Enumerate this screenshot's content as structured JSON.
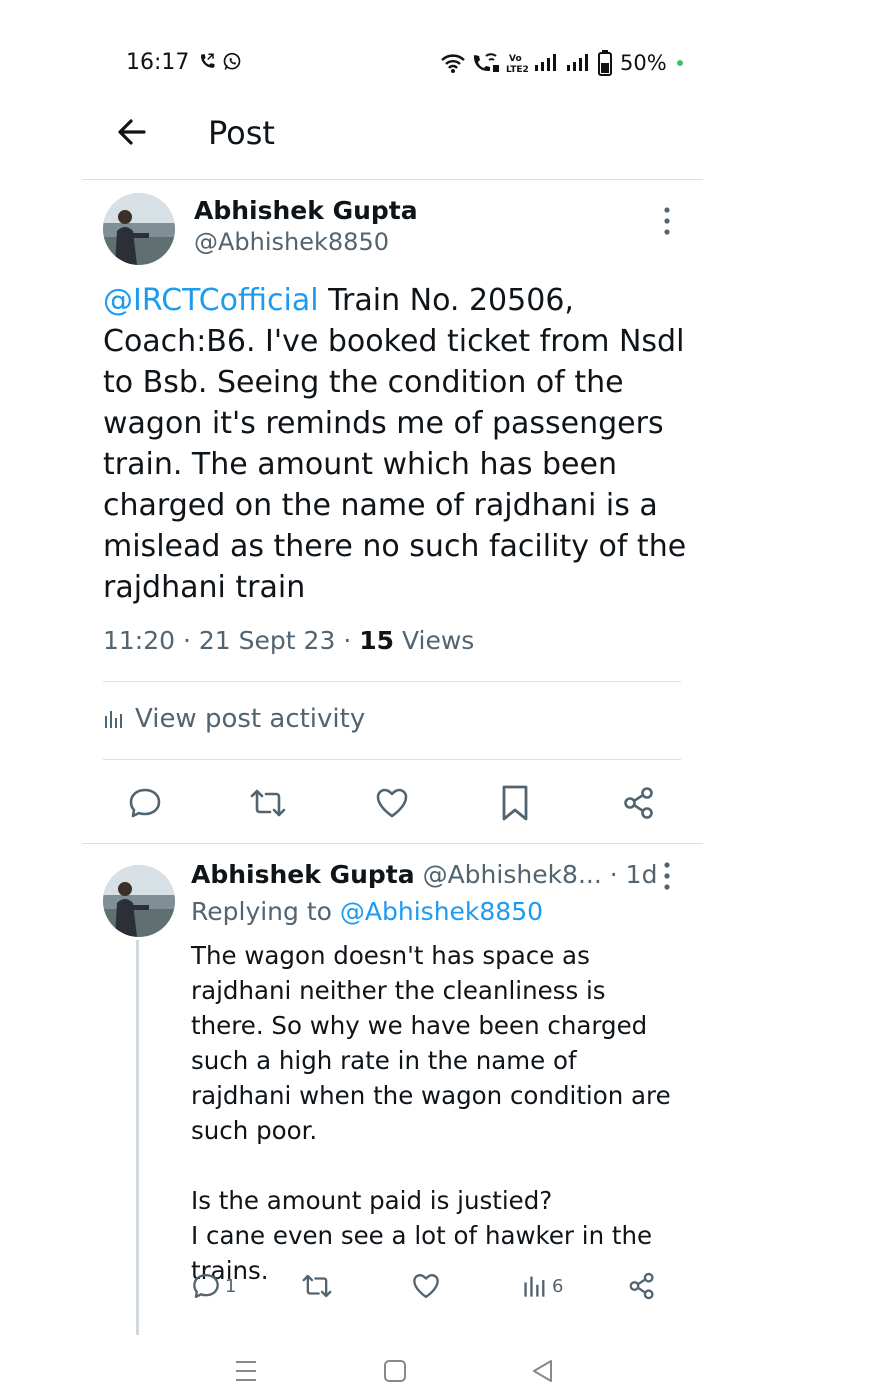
{
  "status_bar": {
    "time": "16:17",
    "battery": "50%",
    "left_icons": [
      "call-forward-icon",
      "whatsapp-icon"
    ],
    "right_icons": [
      "wifi-icon",
      "wifi-call-icon",
      "volte-icon",
      "signal-icon",
      "signal-icon",
      "battery-icon"
    ]
  },
  "header": {
    "title": "Post"
  },
  "post": {
    "author_name": "Abhishek Gupta",
    "author_handle": "@Abhishek8850",
    "mention": "@IRCTCofficial",
    "text": " Train No. 20506, Coach:B6. I've booked ticket from Nsdl to Bsb. Seeing the condition of the wagon it's reminds me of passengers train. The amount which has been charged on the name of rajdhani is a mislead as there no such facility of the rajdhani train",
    "time": "11:20",
    "date": "21 Sept 23",
    "views_count": "15",
    "views_label": "Views",
    "activity_label": "View post activity"
  },
  "reply": {
    "author_name": "Abhishek Gupta",
    "author_handle": "@Abhishek8...",
    "age": "· 1d",
    "replying_prefix": "Replying to",
    "replying_handle": "@Abhishek8850",
    "text": "The wagon doesn't has space as rajdhani neither the cleanliness is there. So why we have been charged such a high rate in the name of rajdhani when the wagon condition are such poor.\n\nIs the amount paid is justied?\nI cane even see a lot of hawker in the trains.",
    "reply_count": "1",
    "views_count": "6"
  },
  "colors": {
    "accent": "#1d9bf0",
    "secondary_text": "#536471",
    "divider": "#dcdfe3"
  }
}
